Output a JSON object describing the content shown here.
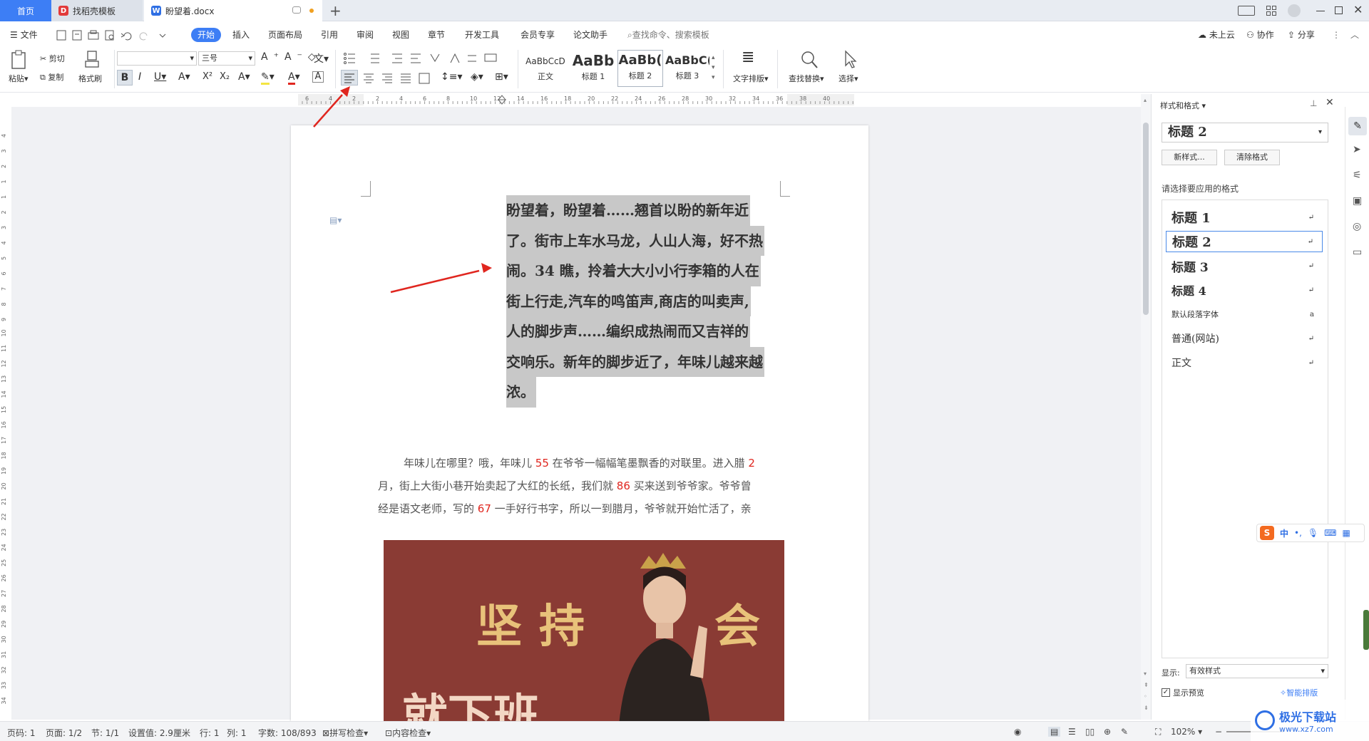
{
  "tabs": {
    "home": "首页",
    "template": "找稻壳模板",
    "document": "盼望着.docx"
  },
  "menu": {
    "file": "文件",
    "items": [
      "开始",
      "插入",
      "页面布局",
      "引用",
      "审阅",
      "视图",
      "章节",
      "开发工具",
      "会员专享",
      "论文助手"
    ],
    "search_placeholder": "查找命令、搜索模板",
    "cloud": "未上云",
    "collab": "协作",
    "share": "分享"
  },
  "ribbon": {
    "paste": "粘贴",
    "cut": "剪切",
    "copy": "复制",
    "format_painter": "格式刷",
    "font_size": "三号",
    "font_name": "",
    "styles": [
      {
        "preview": "AaBbCcD",
        "name": "正文"
      },
      {
        "preview": "AaBb",
        "name": "标题 1"
      },
      {
        "preview": "AaBb(",
        "name": "标题 2"
      },
      {
        "preview": "AaBbC(",
        "name": "标题 3"
      }
    ],
    "text_layout": "文字排版",
    "find_replace": "查找替换",
    "select": "选择"
  },
  "ruler": {
    "top_labels": [
      "6",
      "4",
      "2",
      "2",
      "4",
      "6",
      "8",
      "10",
      "12",
      "14",
      "16",
      "18",
      "20",
      "22",
      "24",
      "26",
      "28",
      "30",
      "32",
      "34",
      "36",
      "38",
      "40"
    ],
    "left_labels": [
      "4",
      "3",
      "2",
      "1",
      "1",
      "2",
      "3",
      "4",
      "5",
      "6",
      "7",
      "8",
      "9",
      "10",
      "11",
      "12",
      "13",
      "14",
      "15",
      "16",
      "17",
      "18",
      "19",
      "20",
      "21",
      "22",
      "23",
      "24",
      "25",
      "26",
      "27",
      "28",
      "29",
      "30",
      "31",
      "32",
      "33",
      "34"
    ]
  },
  "document": {
    "selected_lines": [
      "盼望着，盼望着……翘首以盼的新年近",
      "了。街市上车水马龙，人山人海，好不热",
      "闹。34 瞧，拎着大大小小行李箱的人在",
      "街上行走,汽车的鸣笛声,商店的叫卖声,",
      "人的脚步声……编织成热闹而又吉祥的",
      "交响乐。新年的脚步近了，年味儿越来越",
      "浓。"
    ],
    "body_lines": [
      [
        {
          "t": "年味儿在哪里？哦，年味儿 "
        },
        {
          "t": "55",
          "red": true
        },
        {
          "t": " 在爷爷一幅幅笔墨飘香的对联里。进入腊 "
        },
        {
          "t": "2",
          "red": true
        }
      ],
      [
        {
          "t": "月，街上大街小巷开始卖起了大红的长纸，我们就 "
        },
        {
          "t": "86",
          "red": true
        },
        {
          "t": " 买来送到爷爷家。爷爷曾"
        }
      ],
      [
        {
          "t": "经是语文老师，写的 "
        },
        {
          "t": "67",
          "red": true
        },
        {
          "t": " 一手好行书字，所以一到腊月，爷爷就开始忙活了，亲"
        }
      ]
    ],
    "image_text_top": "坚持",
    "image_text_right": "会",
    "image_text_bottom": "就下班"
  },
  "panel": {
    "title": "样式和格式",
    "current_style": "标题  2",
    "new_style": "新样式...",
    "clear_format": "清除格式",
    "choose_label": "请选择要应用的格式",
    "styles": [
      "标题  1",
      "标题  2",
      "标题  3",
      "标题  4",
      "默认段落字体",
      "普通(网站)",
      "正文"
    ],
    "show_label": "显示:",
    "show_value": "有效样式",
    "preview_label": "显示预览",
    "smart_layout": "智能排版"
  },
  "ime": {
    "lang": "中"
  },
  "status": {
    "page_no": "页码: 1",
    "pages": "页面: 1/2",
    "section": "节: 1/1",
    "setting": "设置值: 2.9厘米",
    "row": "行: 1",
    "col": "列: 1",
    "words": "字数: 108/893",
    "spell": "拼写检查",
    "content": "内容检查",
    "zoom": "102%"
  },
  "watermark": {
    "name": "极光下载站",
    "url": "www.xz7.com"
  },
  "colors": {
    "accent": "#3d7ef5",
    "arrow": "#e0261f",
    "selection": "#c8c8c8",
    "image_bg": "#8a3b34",
    "image_text": "#e8c27a"
  }
}
